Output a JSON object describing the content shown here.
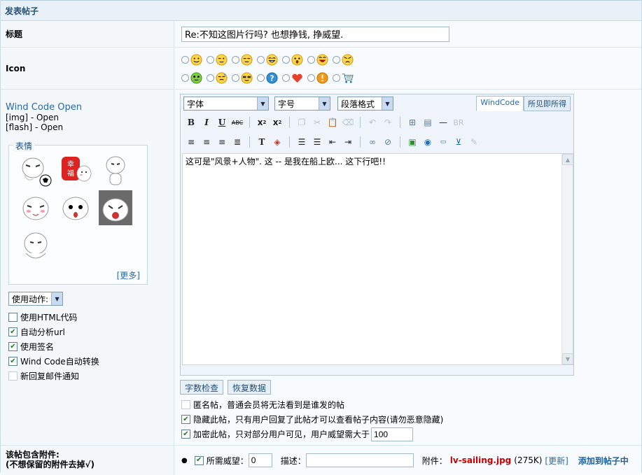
{
  "header": {
    "title": "发表帖子"
  },
  "title_row": {
    "label": "标题",
    "value": "Re:不知这图片行吗? 也想挣钱, 挣威望."
  },
  "icon_row": {
    "label": "Icon",
    "icons": [
      "smile-icon",
      "wink-icon",
      "sleepy-icon",
      "grin-icon",
      "surprised-icon",
      "laugh-icon",
      "angry-icon",
      "alien-icon",
      "sweat-icon",
      "cool-icon",
      "question-icon",
      "heart-icon",
      "alert-icon",
      "cart-icon"
    ]
  },
  "sidebar": {
    "wind_code": "Wind Code Open",
    "img_status": "[img] - Open",
    "flash_status": "[flash] - Open",
    "emoticons_legend": "表情",
    "more": "[更多]",
    "action_select": "使用动作:",
    "options": [
      {
        "label": "使用HTML代码",
        "checked": false
      },
      {
        "label": "自动分析url",
        "checked": true
      },
      {
        "label": "使用签名",
        "checked": true
      },
      {
        "label": "Wind Code自动转换",
        "checked": true
      },
      {
        "label": "新回复邮件通知",
        "checked": false
      }
    ]
  },
  "editor": {
    "font_select": "字体",
    "size_select": "字号",
    "format_select": "段落格式",
    "tab_windcode": "WindCode",
    "tab_wysiwyg": "所见即所得",
    "br_label": "BR",
    "content": "这可是\"风景+人物\". 这 -- 是我在船上欧... 这下行吧!!"
  },
  "buttons": {
    "count": "字数检查",
    "restore": "恢复数据"
  },
  "post_options": [
    {
      "label": "匿名帖，普通会员将无法看到是谁发的帖",
      "checked": false,
      "disabled": true
    },
    {
      "label": "隐藏此帖，只有用户回复了此帖才可以查看帖子内容(请勿恶意隐藏)",
      "checked": true
    },
    {
      "label": "加密此帖，只对部分用户可见，用户威望需大于",
      "checked": true,
      "value": "100"
    }
  ],
  "attachment": {
    "label_line1": "该帖包含附件:",
    "label_line2": "(不想保留的附件去掉√)",
    "prestige_label": "所需威望：",
    "prestige_value": "0",
    "desc_label": "描述：",
    "file_label": "附件：",
    "file_name": "lv-sailing.jpg",
    "file_size": "(275K)",
    "update_link": "[更新]",
    "insert_link": "添加到帖子中"
  }
}
